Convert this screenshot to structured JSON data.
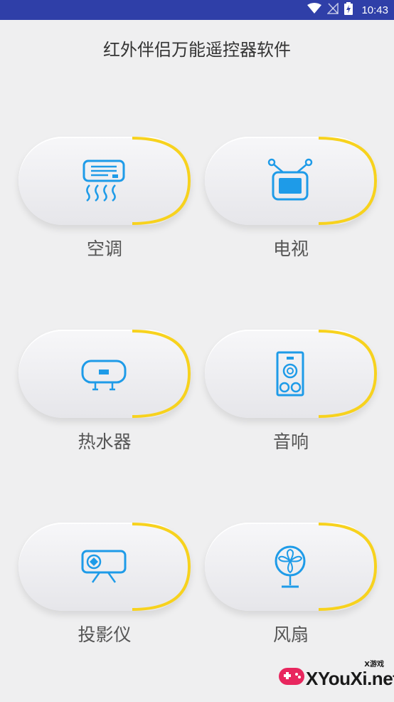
{
  "status_bar": {
    "time": "10:43",
    "icons": [
      "wifi-icon",
      "no-signal-icon",
      "battery-charging-icon"
    ],
    "background": "#2f3fa8"
  },
  "app": {
    "title": "红外伴侣万能遥控器软件"
  },
  "devices": [
    {
      "label": "空调",
      "icon": "air-conditioner-icon"
    },
    {
      "label": "电视",
      "icon": "tv-icon"
    },
    {
      "label": "热水器",
      "icon": "water-heater-icon"
    },
    {
      "label": "音响",
      "icon": "speaker-icon"
    },
    {
      "label": "投影仪",
      "icon": "projector-icon"
    },
    {
      "label": "风扇",
      "icon": "fan-icon"
    }
  ],
  "colors": {
    "icon_blue": "#1e9be8",
    "accent_yellow": "#f7d21e",
    "text": "#555555"
  },
  "watermark": {
    "small_text": "X游戏",
    "brand": "XYouXi.net"
  }
}
